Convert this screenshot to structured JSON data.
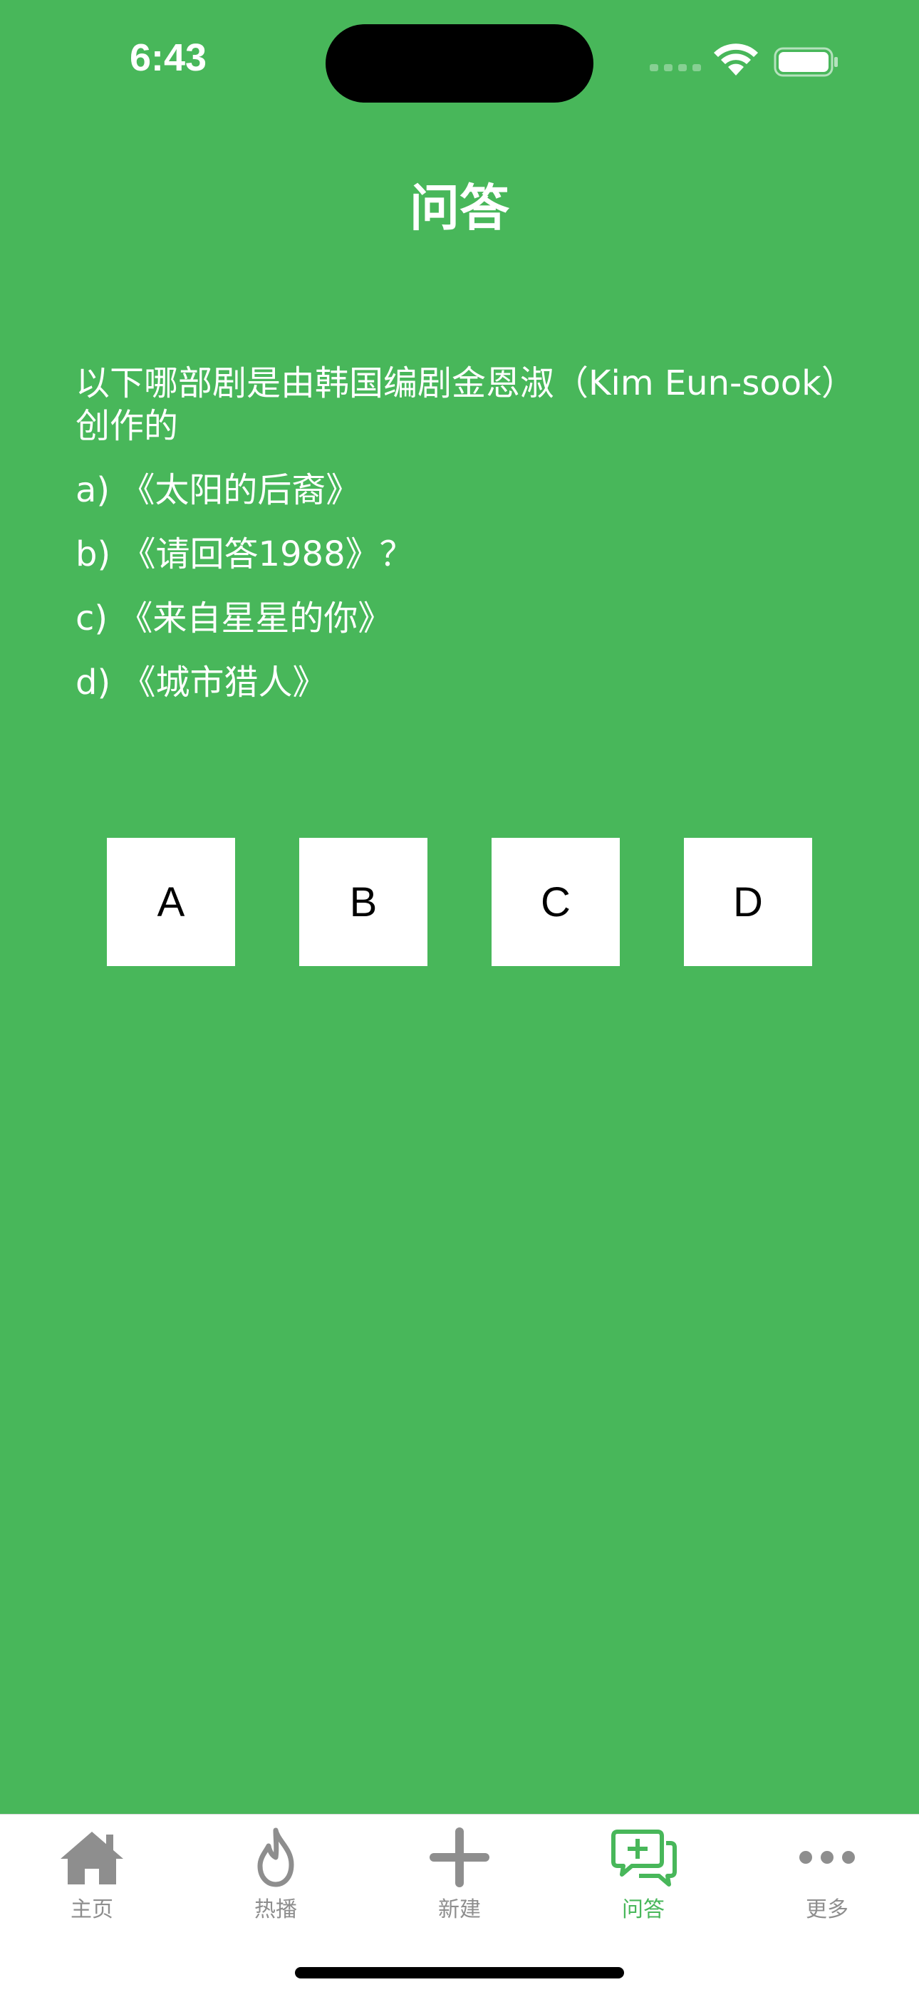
{
  "status_bar": {
    "time": "6:43"
  },
  "nav": {
    "title": "问答"
  },
  "question": {
    "text": "以下哪部剧是由韩国编剧金恩淑（Kim Eun-sook）创作的",
    "options": [
      "a) 《太阳的后裔》",
      "b) 《请回答1988》？",
      "c) 《来自星星的你》",
      "d) 《城市猎人》"
    ]
  },
  "answers": [
    "A",
    "B",
    "C",
    "D"
  ],
  "tab_bar": {
    "items": [
      {
        "label": "主页",
        "icon": "house-icon"
      },
      {
        "label": "热播",
        "icon": "flame-icon"
      },
      {
        "label": "新建",
        "icon": "plus-icon"
      },
      {
        "label": "问答",
        "icon": "chat-plus-icon",
        "active": true
      },
      {
        "label": "更多",
        "icon": "ellipsis-icon"
      }
    ],
    "active_color": "#48b75a",
    "inactive_color": "#8e8e8e"
  },
  "colors": {
    "background": "#48b75a",
    "button": "#ffffff"
  }
}
